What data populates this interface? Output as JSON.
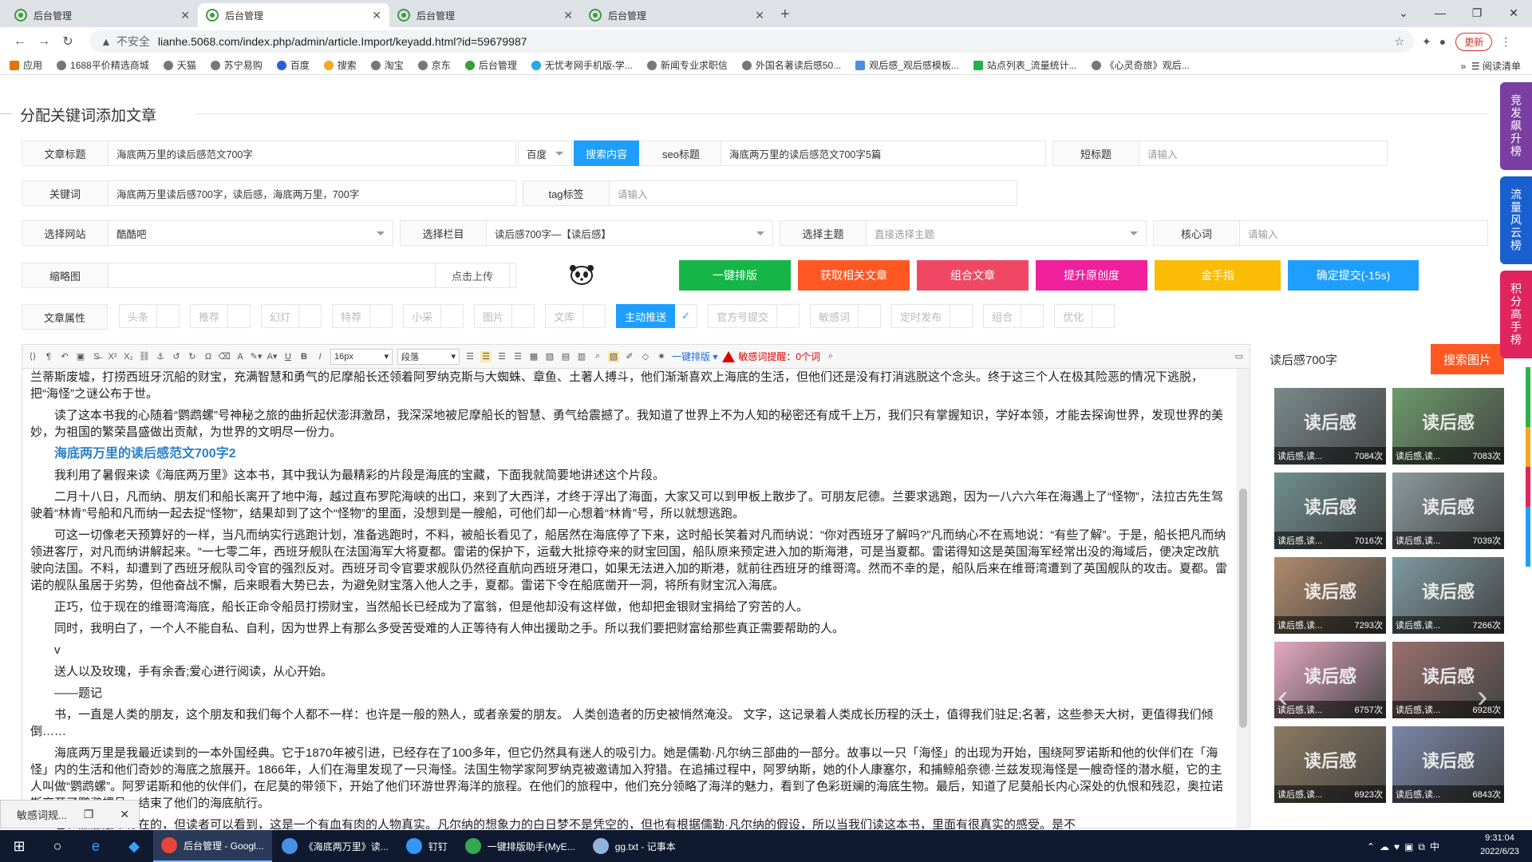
{
  "browser": {
    "tabs": [
      {
        "label": "后台管理",
        "active": false
      },
      {
        "label": "后台管理",
        "active": true
      },
      {
        "label": "后台管理",
        "active": false
      },
      {
        "label": "后台管理",
        "active": false
      }
    ],
    "insecure_label": "不安全",
    "url": "lianhe.5068.com/index.php/admin/article.Import/keyadd.html?id=59679987",
    "update_label": "更新",
    "bookmarks": [
      "应用",
      "1688平价精选商城",
      "天猫",
      "苏宁易购",
      "百度",
      "搜索",
      "淘宝",
      "京东",
      "后台管理",
      "无忧考网手机版-学...",
      "新闻专业求职信",
      "外国名著读后感50...",
      "观后感_观后感模板...",
      "站点列表_流量统计...",
      "《心灵奇旅》观后..."
    ],
    "reading_list": "阅读清单"
  },
  "page": {
    "title": "分配关键词添加文章",
    "row1": {
      "article_title_label": "文章标题",
      "article_title_value": "海底两万里的读后感范文700字",
      "engine": "百度",
      "search_btn": "搜索内容",
      "seo_label": "seo标题",
      "seo_value": "海底两万里的读后感范文700字5篇",
      "short_label": "短标题",
      "short_placeholder": "请输入"
    },
    "row2": {
      "keyword_label": "关键词",
      "keyword_value": "海底两万里读后感700字，读后感，海底两万里，700字",
      "tag_label": "tag标签",
      "tag_placeholder": "请输入"
    },
    "row3": {
      "site_label": "选择网站",
      "site_value": "酷酷吧",
      "column_label": "选择栏目",
      "column_value": "读后感700字—【读后感】",
      "theme_label": "选择主题",
      "theme_placeholder": "直接选择主题",
      "core_label": "核心词",
      "core_placeholder": "请输入"
    },
    "row4": {
      "thumb_label": "缩略图",
      "upload_btn": "点击上传",
      "actions": [
        {
          "label": "一键排版",
          "color": "#16b548"
        },
        {
          "label": "获取相关文章",
          "color": "#ff5722"
        },
        {
          "label": "组合文章",
          "color": "#f04864"
        },
        {
          "label": "提升原创度",
          "color": "#f01f9b"
        },
        {
          "label": "金手指",
          "color": "#fbbc05"
        },
        {
          "label": "确定提交(-15s)",
          "color": "#1e9fff"
        }
      ]
    },
    "attrs_label": "文章属性",
    "attrs": [
      {
        "label": "头条",
        "on": false
      },
      {
        "label": "推荐",
        "on": false
      },
      {
        "label": "幻灯",
        "on": false
      },
      {
        "label": "特荐",
        "on": false
      },
      {
        "label": "小采",
        "on": false
      },
      {
        "label": "图片",
        "on": false
      },
      {
        "label": "文库",
        "on": false
      },
      {
        "label": "主动推送",
        "on": true
      },
      {
        "label": "官方号提交",
        "on": false
      },
      {
        "label": "敏感词",
        "on": false
      },
      {
        "label": "定时发布",
        "on": false
      },
      {
        "label": "组合",
        "on": false
      },
      {
        "label": "优化",
        "on": false
      }
    ],
    "toolbar": {
      "font_size": "16px",
      "paragraph": "段落",
      "one_key": "一键排版",
      "sensitive_warning": "敏感词提醒：0个词"
    },
    "content": [
      {
        "type": "p",
        "indent": false,
        "text": "兰蒂斯废墟，打捞西班牙沉船的财宝，充满智慧和勇气的尼摩船长还领着阿罗纳克斯与大蜘蛛、章鱼、土著人搏斗，他们渐渐喜欢上海底的生活，但他们还是没有打消逃脱这个念头。终于这三个人在极其险恶的情况下逃脱，把“海怪”之谜公布于世。"
      },
      {
        "type": "p",
        "indent": true,
        "text": "读了这本书我的心随着“鹦鹉螺”号神秘之旅的曲折起伏澎湃激昂，我深深地被尼摩船长的智慧、勇气给震撼了。我知道了世界上不为人知的秘密还有成千上万，我们只有掌握知识，学好本领，才能去探询世界，发现世界的美妙，为祖国的繁荣昌盛做出贡献，为世界的文明尽一份力。"
      },
      {
        "type": "h",
        "text": "海底两万里的读后感范文700字2"
      },
      {
        "type": "p",
        "indent": true,
        "text": "我利用了暑假来读《海底两万里》这本书，其中我认为最精彩的片段是海底的宝藏，下面我就简要地讲述这个片段。"
      },
      {
        "type": "p",
        "indent": true,
        "text": "二月十八日，凡而纳、朋友们和船长离开了地中海，越过直布罗陀海峡的出口，来到了大西洋，才终于浮出了海面，大家又可以到甲板上散步了。可朋友尼德。兰要求逃跑，因为一八六六年在海遇上了“怪物”，法拉古先生驾驶着“林肯”号船和凡而纳一起去捉“怪物”，结果却到了这个“怪物”的里面，没想到是一艘船，可他们却一心想着“林肯”号，所以就想逃跑。"
      },
      {
        "type": "p",
        "indent": true,
        "text": "可这一切像老天预算好的一样，当凡而纳实行逃跑计划，准备逃跑时，不料，被船长看见了，船居然在海底停了下来，这时船长笑着对凡而纳说：“你对西班牙了解吗?”凡而纳心不在焉地说：“有些了解”。于是，船长把凡而纳领进客厅，对凡而纳讲解起来。“一七零二年，西班牙舰队在法国海军大将夏都。雷诺的保护下，运载大批掠夺来的财宝回国，船队原来预定进入加的斯海港，可是当夏都。雷诺得知这是英国海军经常出没的海域后，便决定改航驶向法国。不料，却遭到了西班牙舰队司令官的强烈反对。西班牙司令官要求舰队仍然径直航向西班牙港口，如果无法进入加的斯港，就前往西班牙的维哥湾。然而不幸的是，船队后来在维哥湾遭到了英国舰队的攻击。夏都。雷诺的舰队虽居于劣势，但他奋战不懈，后来眼看大势已去，为避免财宝落入他人之手，夏都。雷诺下令在船底凿开一洞，将所有财宝沉入海底。"
      },
      {
        "type": "p",
        "indent": true,
        "text": "正巧，位于现在的维哥湾海底，船长正命令船员打捞财宝，当然船长已经成为了富翁，但是他却没有这样做，他却把金银财宝捐给了穷苦的人。"
      },
      {
        "type": "p",
        "indent": true,
        "text": "同时，我明白了，一个人不能自私、自利，因为世界上有那么多受苦受难的人正等待有人伸出援助之手。所以我们要把财富给那些真正需要帮助的人。"
      },
      {
        "type": "p",
        "indent": true,
        "text": "v"
      },
      {
        "type": "p",
        "indent": true,
        "text": "送人以及玫瑰，手有余香;爱心进行阅读，从心开始。"
      },
      {
        "type": "p",
        "indent": true,
        "text": "——题记"
      },
      {
        "type": "p",
        "indent": true,
        "text": "书，一直是人类的朋友，这个朋友和我们每个人都不一样：也许是一般的熟人，或者亲爱的朋友。 人类创造者的历史被悄然淹没。 文字，这记录着人类成长历程的沃土，值得我们驻足;名著，这些参天大树，更值得我们倾倒……"
      },
      {
        "type": "p",
        "indent": true,
        "text": "海底两万里是我最近读到的一本外国经典。它于1870年被引进，已经存在了100多年，但它仍然具有迷人的吸引力。她是儒勒·凡尔纳三部曲的一部分。故事以一只「海怪」的出现为开始，围绕阿罗诺斯和他的伙伴们在「海怪」内的生活和他们奇妙的海底之旅展开。1866年，人们在海里发现了一只海怪。法国生物学家阿罗纳克被邀请加入狩猎。在追捕过程中，阿罗纳斯，她的仆人康塞尔，和捕鲸船奈德·兰兹发现海怪是一艘奇怪的潜水艇，它的主人叫做“鹦鹉螺”。阿罗诺斯和他的伙伴们，在尼莫的带领下，开始了他们环游世界海洋的旅程。在他们的旅程中，他们充分领略了海洋的魅力，看到了色彩斑斓的海底生物。最后，知道了尼莫船长内心深处的仇恨和残忍，奥拉诺斯离开了鹦鹉螺号，结束了他们的海底航行。"
      },
      {
        "type": "p",
        "indent": true,
        "text": "名，意思是不存在的，但读者可以看到，这是一个有血有肉的人物真实。凡尔纳的想象力的白日梦不是凭空的，但也有根据儒勒·凡尔纳的假设，所以当我们读这本书，里面有很真实的感受。是不"
      }
    ],
    "right_panel": {
      "keyword": "读后感700字",
      "search_btn": "搜索图片",
      "cards": [
        {
          "big": "读后感",
          "cap": "读后感,读...",
          "views": "7084次"
        },
        {
          "big": "读后感",
          "cap": "读后感,读...",
          "views": "7083次"
        },
        {
          "big": "读后感",
          "cap": "读后感,读...",
          "views": "7016次"
        },
        {
          "big": "读后感",
          "cap": "读后感,读...",
          "views": "7039次"
        },
        {
          "big": "读后感",
          "cap": "读后感,读...",
          "views": "7293次"
        },
        {
          "big": "读后感",
          "cap": "读后感,读...",
          "views": "7266次"
        },
        {
          "big": "读后感",
          "cap": "读后感,读...",
          "views": "6757次"
        },
        {
          "big": "读后感",
          "cap": "读后感,读...",
          "views": "6928次"
        },
        {
          "big": "读后感",
          "cap": "读后感,读...",
          "views": "6923次"
        },
        {
          "big": "读后感",
          "cap": "读后感,读...",
          "views": "6843次"
        }
      ]
    },
    "side_tags": [
      {
        "label": "竞发飙升榜",
        "color": "#7a3fa0"
      },
      {
        "label": "流量风云榜",
        "color": "#1a5fd0"
      },
      {
        "label": "积分高手榜",
        "color": "#e0245e"
      }
    ]
  },
  "popup": {
    "label": "敏感词规..."
  },
  "taskbar": {
    "apps": [
      {
        "label": "后台管理 - Googl...",
        "active": true,
        "color": "#e8453c"
      },
      {
        "label": "《海底两万里》读...",
        "active": false,
        "color": "#4a90e2"
      },
      {
        "label": "钉钉",
        "active": false,
        "color": "#3296fa"
      },
      {
        "label": "一键排版助手(MyE...",
        "active": false,
        "color": "#34a853"
      },
      {
        "label": "gg.txt - 记事本",
        "active": false,
        "color": "#8fb4d8"
      }
    ],
    "time": "9:31:04",
    "date": "2022/6/23"
  }
}
